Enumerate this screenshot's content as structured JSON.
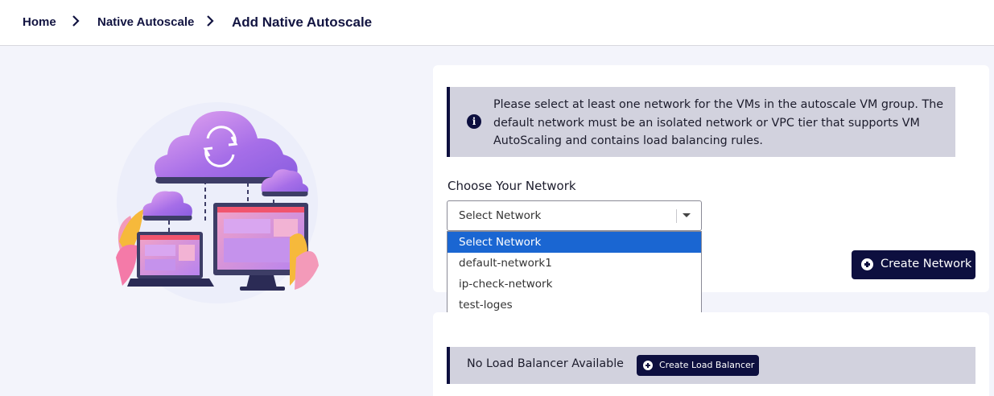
{
  "breadcrumb": {
    "items": [
      "Home",
      "Native Autoscale",
      "Add Native Autoscale"
    ]
  },
  "network_card": {
    "info_text": "Please select at least one network for the VMs in the autoscale VM group. The default network must be an isolated network or VPC tier that supports VM AutoScaling and contains load balancing rules.",
    "choose_label": "Choose Your Network",
    "select": {
      "value": "Select Network",
      "options": [
        "Select Network",
        "default-network1",
        "ip-check-network",
        "test-loges"
      ],
      "highlighted_option": "Select Network"
    },
    "create_network_label": "Create Network"
  },
  "lb_card": {
    "message": "No Load Balancer Available",
    "create_lb_label": "Create Load Balancer"
  },
  "colors": {
    "primary": "#0d0f3f",
    "highlight": "#1a66d2",
    "info_bg": "#d2d2de",
    "page_bg": "#f3f4fb"
  },
  "icons": {
    "breadcrumb_separator": "chevron-right-icon",
    "info": "info-icon",
    "dropdown": "caret-down-icon",
    "button_add": "plus-circle-icon",
    "illustration": "cloud-devices-illustration"
  }
}
